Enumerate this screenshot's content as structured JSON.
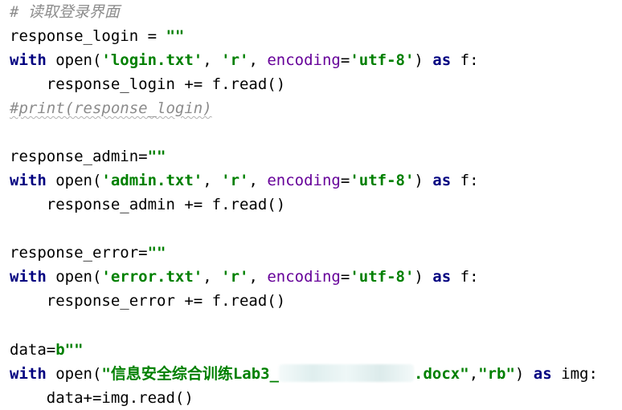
{
  "colors": {
    "keyword": "#000080",
    "string": "#008000",
    "param": "#660099",
    "comment": "#8c8c8c"
  },
  "lines": [
    [
      {
        "t": "# 读取登录界面",
        "c": "comment"
      }
    ],
    [
      {
        "t": "response_login = ",
        "c": "plain"
      },
      {
        "t": "\"\"",
        "c": "str"
      }
    ],
    [
      {
        "t": "with",
        "c": "kw"
      },
      {
        "t": " open(",
        "c": "plain"
      },
      {
        "t": "'login.txt'",
        "c": "str"
      },
      {
        "t": ", ",
        "c": "plain"
      },
      {
        "t": "'r'",
        "c": "str"
      },
      {
        "t": ", ",
        "c": "plain"
      },
      {
        "t": "encoding",
        "c": "param"
      },
      {
        "t": "=",
        "c": "plain"
      },
      {
        "t": "'utf-8'",
        "c": "str"
      },
      {
        "t": ") ",
        "c": "plain"
      },
      {
        "t": "as",
        "c": "kw"
      },
      {
        "t": " f:",
        "c": "plain"
      }
    ],
    [
      {
        "t": "    response_login += f.read()",
        "c": "plain"
      }
    ],
    [
      {
        "t": "#print(response_login)",
        "c": "comment",
        "squiggle": true
      }
    ],
    [],
    [
      {
        "t": "response_admin=",
        "c": "plain"
      },
      {
        "t": "\"\"",
        "c": "str"
      }
    ],
    [
      {
        "t": "with",
        "c": "kw"
      },
      {
        "t": " open(",
        "c": "plain"
      },
      {
        "t": "'admin.txt'",
        "c": "str"
      },
      {
        "t": ", ",
        "c": "plain"
      },
      {
        "t": "'r'",
        "c": "str"
      },
      {
        "t": ", ",
        "c": "plain"
      },
      {
        "t": "encoding",
        "c": "param"
      },
      {
        "t": "=",
        "c": "plain"
      },
      {
        "t": "'utf-8'",
        "c": "str"
      },
      {
        "t": ") ",
        "c": "plain"
      },
      {
        "t": "as",
        "c": "kw"
      },
      {
        "t": " f:",
        "c": "plain"
      }
    ],
    [
      {
        "t": "    response_admin += f.read()",
        "c": "plain"
      }
    ],
    [],
    [
      {
        "t": "response_error=",
        "c": "plain"
      },
      {
        "t": "\"\"",
        "c": "str"
      }
    ],
    [
      {
        "t": "with",
        "c": "kw"
      },
      {
        "t": " open(",
        "c": "plain"
      },
      {
        "t": "'error.txt'",
        "c": "str"
      },
      {
        "t": ", ",
        "c": "plain"
      },
      {
        "t": "'r'",
        "c": "str"
      },
      {
        "t": ", ",
        "c": "plain"
      },
      {
        "t": "encoding",
        "c": "param"
      },
      {
        "t": "=",
        "c": "plain"
      },
      {
        "t": "'utf-8'",
        "c": "str"
      },
      {
        "t": ") ",
        "c": "plain"
      },
      {
        "t": "as",
        "c": "kw"
      },
      {
        "t": " f:",
        "c": "plain"
      }
    ],
    [
      {
        "t": "    response_error += f.read()",
        "c": "plain"
      }
    ],
    [],
    [
      {
        "t": "data=",
        "c": "plain"
      },
      {
        "t": "b\"\"",
        "c": "str"
      }
    ],
    [
      {
        "t": "with",
        "c": "kw"
      },
      {
        "t": " open(",
        "c": "plain"
      },
      {
        "t": "\"信息安全综合训练Lab3_",
        "c": "str"
      },
      {
        "t": "",
        "c": "redacted"
      },
      {
        "t": ".docx\"",
        "c": "str"
      },
      {
        "t": ",",
        "c": "plain"
      },
      {
        "t": "\"rb\"",
        "c": "str"
      },
      {
        "t": ") ",
        "c": "plain"
      },
      {
        "t": "as",
        "c": "kw"
      },
      {
        "t": " img:",
        "c": "plain"
      }
    ],
    [
      {
        "t": "    data+=img.read()",
        "c": "plain"
      }
    ]
  ]
}
